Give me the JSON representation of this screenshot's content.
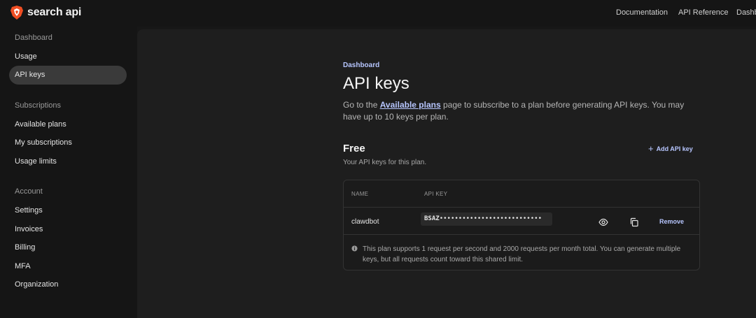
{
  "header": {
    "logo_text": "search api",
    "nav": [
      "Documentation",
      "API Reference",
      "Dashb"
    ]
  },
  "sidebar": {
    "sections": [
      {
        "heading": "Dashboard",
        "items": [
          "Usage",
          "API keys"
        ]
      },
      {
        "heading": "Subscriptions",
        "items": [
          "Available plans",
          "My subscriptions",
          "Usage limits"
        ]
      },
      {
        "heading": "Account",
        "items": [
          "Settings",
          "Invoices",
          "Billing",
          "MFA",
          "Organization"
        ]
      }
    ],
    "active_item": "API keys"
  },
  "main": {
    "breadcrumb": "Dashboard",
    "title": "API keys",
    "intro_before_link": "Go to the ",
    "intro_link": "Available plans",
    "intro_after_link": " page to subscribe to a plan before generating API keys. You may have up to 10 keys per plan.",
    "plan": {
      "title": "Free",
      "subtitle": "Your API keys for this plan.",
      "add_button": "Add API key",
      "table": {
        "headers": [
          "NAME",
          "API KEY"
        ],
        "rows": [
          {
            "name": "clawdbot",
            "key_prefix": "BSAZ",
            "key_mask": "•••••••••••••••••••••••••••",
            "remove_label": "Remove"
          }
        ]
      },
      "note": "This plan supports 1 request per second and 2000 requests per month total. You can generate multiple keys, but all requests count toward this shared limit."
    }
  },
  "colors": {
    "accent": "#b7c6ff",
    "brand": "#f04e23",
    "background": "#171717",
    "panel": "#1e1e1e"
  }
}
